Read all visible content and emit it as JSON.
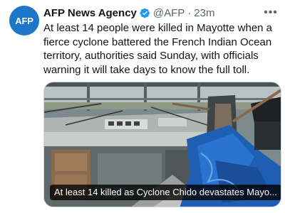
{
  "tweet": {
    "avatar_text": "AFP",
    "author_name": "AFP News Agency",
    "handle": "@AFP",
    "separator": "·",
    "time": "23m",
    "verified_icon": "verified-badge-icon",
    "more_icon": "more-options-icon",
    "text": "At least 14 people were killed in Mayotte when a fierce cyclone battered the French Indian Ocean territory, authorities said Sunday, with officials warning it will take days to know the full toll.",
    "media": {
      "caption": "At least 14 killed as Cyclone Chido devastates Mayo..."
    }
  },
  "colors": {
    "avatar_bg": "#1d77c9",
    "verified": "#1d9bf0",
    "secondary_text": "#536471",
    "tarp_blue": "#1f5fb3"
  }
}
